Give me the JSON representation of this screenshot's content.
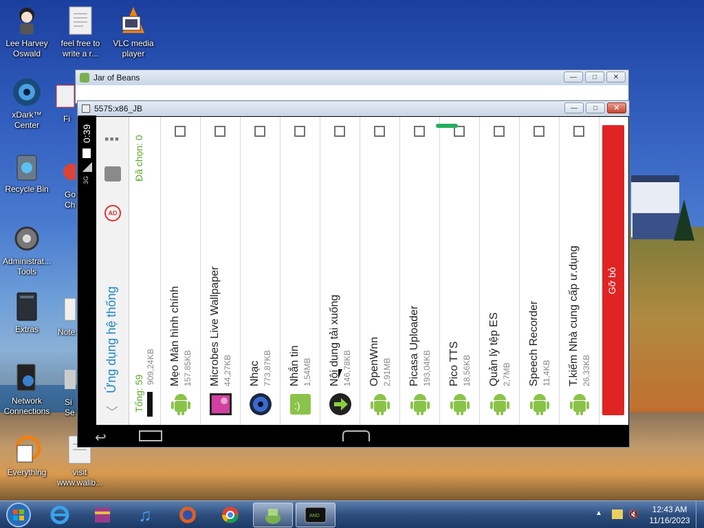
{
  "desktop": {
    "icons": [
      {
        "label": "Lee Harvey Oswald",
        "icon": "person-icon"
      },
      {
        "label": "feel free to write a r...",
        "icon": "document-icon"
      },
      {
        "label": "VLC media player",
        "icon": "vlc-icon"
      },
      {
        "label": "xDark™ Center",
        "icon": "xdark-icon"
      },
      {
        "label": "Fi",
        "icon": "folder-icon"
      },
      {
        "label": "Recycle Bin",
        "icon": "recycle-bin-icon"
      },
      {
        "label": "Go Ch",
        "icon": "chrome-icon"
      },
      {
        "label": "Administrat... Tools",
        "icon": "admin-tools-icon"
      },
      {
        "label": "Extras",
        "icon": "folder-icon"
      },
      {
        "label": "Note",
        "icon": "document-icon"
      },
      {
        "label": "Network Connections",
        "icon": "network-icon"
      },
      {
        "label": "Si Se",
        "icon": "app-icon"
      },
      {
        "label": "Everything",
        "icon": "everything-icon"
      },
      {
        "label": "visit www.wallb...",
        "icon": "document-icon"
      }
    ]
  },
  "outer_window": {
    "title": "Jar of Beans"
  },
  "inner_window": {
    "title": "5575:x86_JB"
  },
  "android": {
    "status": {
      "time": "0:39",
      "signal": "3G"
    },
    "header": {
      "title": "Ứng dụng hệ thống",
      "total": "Tổng: 59",
      "selected": "Đã chọn: 0",
      "partial_size": "909,24KB"
    },
    "apps": [
      {
        "name": "Mẹo Màn hình chính",
        "size": "157,85KB",
        "icon": "android-robot-icon"
      },
      {
        "name": "Microbes Live Wallpaper",
        "size": "44,27KB",
        "icon": "wallpaper-icon"
      },
      {
        "name": "Nhạc",
        "size": "773,87KB",
        "icon": "music-icon"
      },
      {
        "name": "Nhắn tin",
        "size": "1,54MB",
        "icon": "messaging-icon"
      },
      {
        "name": "Nội dung tải xuống",
        "size": "146,78KB",
        "icon": "download-icon"
      },
      {
        "name": "OpenWnn",
        "size": "2,91MB",
        "icon": "android-robot-icon"
      },
      {
        "name": "Picasa Uploader",
        "size": "193,04KB",
        "icon": "android-robot-icon"
      },
      {
        "name": "Pico TTS",
        "size": "18,56KB",
        "icon": "android-robot-icon"
      },
      {
        "name": "Quản lý tệp ES",
        "size": "2,7MB",
        "icon": "android-robot-icon"
      },
      {
        "name": "Speech Recorder",
        "size": "11,4KB",
        "icon": "android-robot-icon"
      },
      {
        "name": "T.kiếm Nhà cung cấp ư.dụng",
        "size": "26,33KB",
        "icon": "android-robot-icon"
      }
    ],
    "uninstall_label": "Gỡ bỏ",
    "colors": {
      "accent_green": "#5ba62a",
      "uninstall_red": "#e02424",
      "text_blue": "#1e88c8",
      "nav_bar": "#000000"
    }
  },
  "taskbar": {
    "items": [
      "windows-start-icon",
      "internet-explorer-icon",
      "winrar-icon",
      "itunes-icon",
      "firefox-icon",
      "chrome-icon",
      "jar-of-beans-icon",
      "android-emulator-icon"
    ],
    "clock": {
      "time": "12:43 AM",
      "date": "11/16/2023"
    }
  }
}
